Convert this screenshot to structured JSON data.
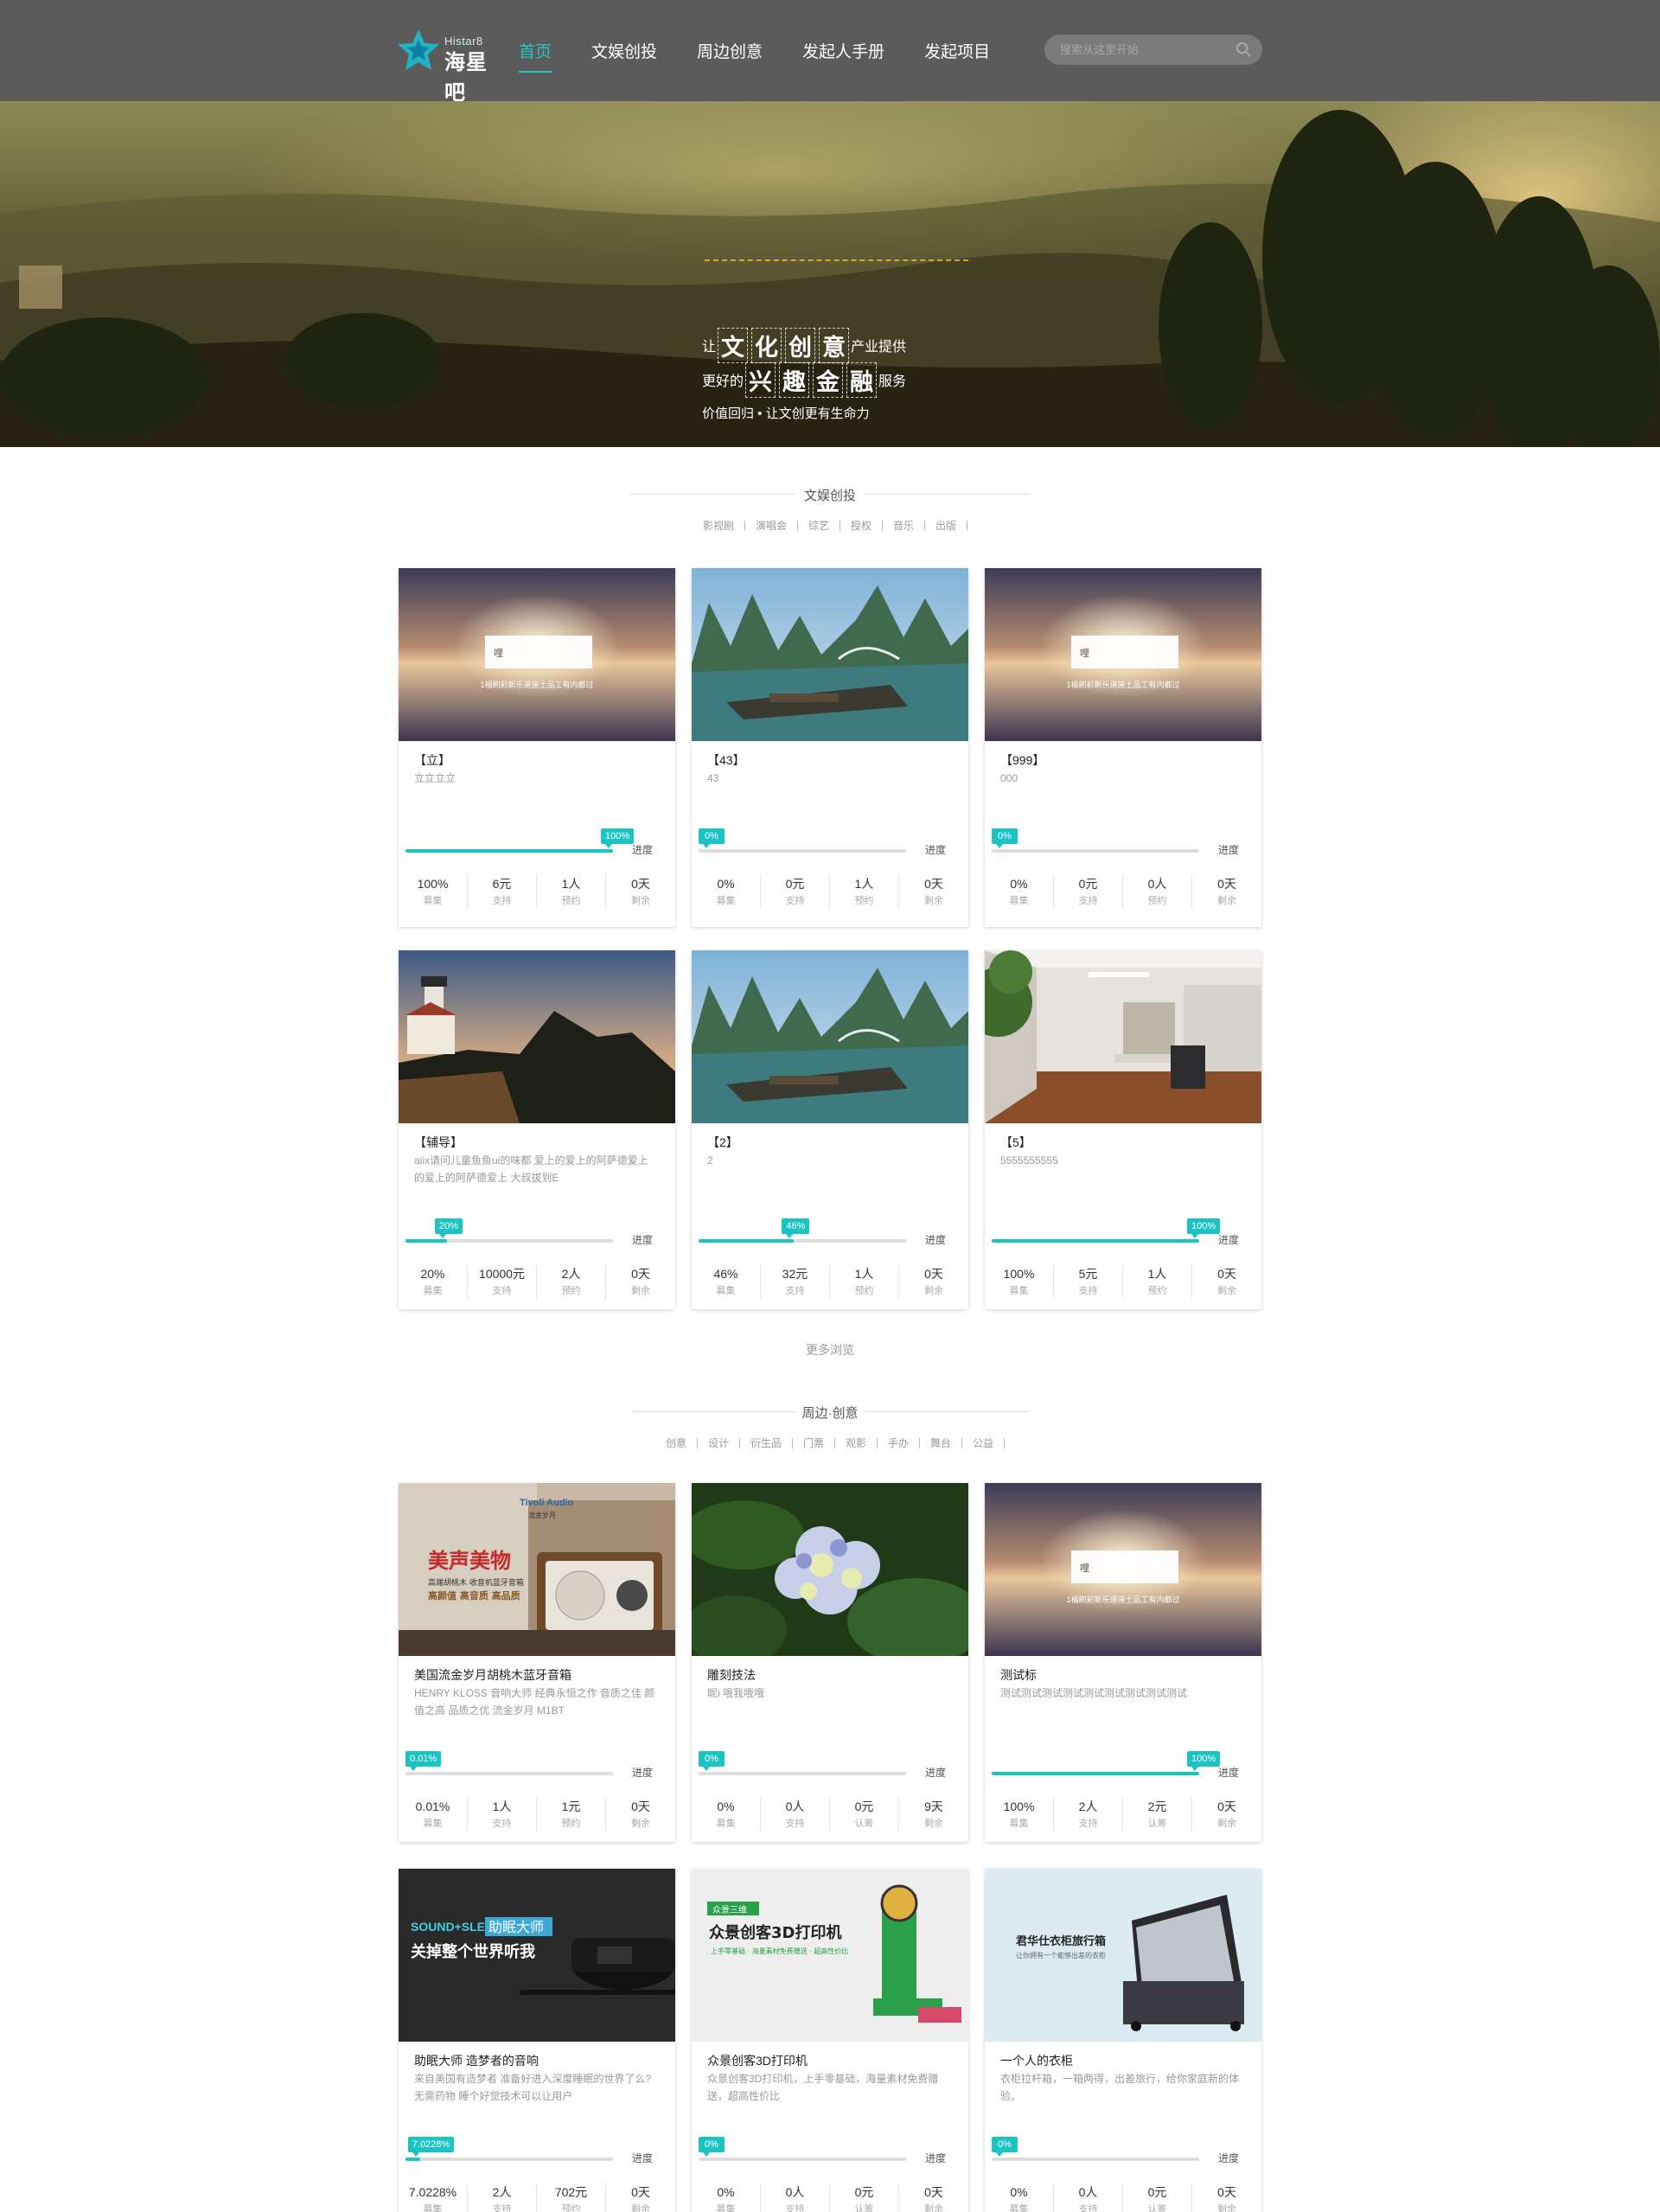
{
  "header": {
    "logo_en": "Histar8",
    "logo_cn": "海星吧",
    "nav": [
      "首页",
      "文娱创投",
      "周边创意",
      "发起人手册",
      "发起项目"
    ],
    "search_placeholder": "搜索从这里开始"
  },
  "banner": {
    "line1_pre": "让",
    "line1_big": [
      "文",
      "化",
      "创",
      "意"
    ],
    "line1_post": "产业提供",
    "line2_pre": "更好的",
    "line2_big": [
      "兴",
      "趣",
      "金",
      "融"
    ],
    "line2_post": "服务",
    "line3": "价值回归 • 让文创更有生命力"
  },
  "section1": {
    "title": "文娱创投",
    "categories": [
      "影视剧",
      "演唱会",
      "综艺",
      "授权",
      "音乐",
      "出版"
    ],
    "more": "更多浏览",
    "cards": [
      {
        "title": "【立】",
        "desc": "立立立立",
        "progress": 100,
        "tag": "100%",
        "stats": [
          [
            "100%",
            "募集"
          ],
          [
            "6元",
            "支持"
          ],
          [
            "1人",
            "预约"
          ],
          [
            "0天",
            "剩余"
          ]
        ]
      },
      {
        "title": "【43】",
        "desc": "43",
        "progress": 0,
        "tag": "0%",
        "stats": [
          [
            "0%",
            "募集"
          ],
          [
            "0元",
            "支持"
          ],
          [
            "1人",
            "预约"
          ],
          [
            "0天",
            "剩余"
          ]
        ]
      },
      {
        "title": "【999】",
        "desc": "000",
        "progress": 0,
        "tag": "0%",
        "stats": [
          [
            "0%",
            "募集"
          ],
          [
            "0元",
            "支持"
          ],
          [
            "0人",
            "预约"
          ],
          [
            "0天",
            "剩余"
          ]
        ]
      },
      {
        "title": "【辅导】",
        "desc": "aiix请问儿童鱼鱼ui的味都 爱上的爱上的阿萨德爱上的爱上的阿萨德爱上 大叔拔到E",
        "progress": 20,
        "tag": "20%",
        "stats": [
          [
            "20%",
            "募集"
          ],
          [
            "10000元",
            "支持"
          ],
          [
            "2人",
            "预约"
          ],
          [
            "0天",
            "剩余"
          ]
        ]
      },
      {
        "title": "【2】",
        "desc": "2",
        "progress": 46,
        "tag": "46%",
        "stats": [
          [
            "46%",
            "募集"
          ],
          [
            "32元",
            "支持"
          ],
          [
            "1人",
            "预约"
          ],
          [
            "0天",
            "剩余"
          ]
        ]
      },
      {
        "title": "【5】",
        "desc": "5555555555",
        "progress": 100,
        "tag": "100%",
        "stats": [
          [
            "100%",
            "募集"
          ],
          [
            "5元",
            "支持"
          ],
          [
            "1人",
            "预约"
          ],
          [
            "0天",
            "剩余"
          ]
        ]
      }
    ]
  },
  "section2": {
    "title": "周边·创意",
    "categories": [
      "创意",
      "设计",
      "衍生品",
      "门票",
      "观影",
      "手办",
      "舞台",
      "公益"
    ],
    "cards": [
      {
        "title": "美国流金岁月胡桃木蓝牙音箱",
        "desc": "HENRY KLOSS 音响大师 经典永恒之作 音质之佳 颜值之高 品质之优 流金岁月 M1BT",
        "progress": 0.01,
        "tag": "0.01%",
        "stats": [
          [
            "0.01%",
            "募集"
          ],
          [
            "1人",
            "支持"
          ],
          [
            "1元",
            "预约"
          ],
          [
            "0天",
            "剩余"
          ]
        ]
      },
      {
        "title": "雕刻技法",
        "desc": "昵i 哦我哦哦",
        "progress": 0,
        "tag": "0%",
        "stats": [
          [
            "0%",
            "募集"
          ],
          [
            "0人",
            "支持"
          ],
          [
            "0元",
            "认筹"
          ],
          [
            "9天",
            "剩余"
          ]
        ]
      },
      {
        "title": "测试标",
        "desc": "测试测试测试测试测试测试测试测试测试",
        "progress": 100,
        "tag": "100%",
        "stats": [
          [
            "100%",
            "募集"
          ],
          [
            "2人",
            "支持"
          ],
          [
            "2元",
            "认筹"
          ],
          [
            "0天",
            "剩余"
          ]
        ]
      },
      {
        "title": "助眠大师 造梦者的音响",
        "desc": "来自美国有造梦者 准备好进入深度睡眠的世界了么? 无需药物 睡个好觉技术可以让用户",
        "progress": 7.0228,
        "tag": "7.0228%",
        "stats": [
          [
            "7.0228%",
            "募集"
          ],
          [
            "2人",
            "支持"
          ],
          [
            "702元",
            "预约"
          ],
          [
            "0天",
            "剩余"
          ]
        ]
      },
      {
        "title": "众景创客3D打印机",
        "desc": "众景创客3D打印机，上手零基础，海量素材免费赠送，超高性价比",
        "progress": 0,
        "tag": "0%",
        "stats": [
          [
            "0%",
            "募集"
          ],
          [
            "0人",
            "支持"
          ],
          [
            "0元",
            "认筹"
          ],
          [
            "0天",
            "剩余"
          ]
        ]
      },
      {
        "title": "一个人的衣柜",
        "desc": "衣柜拉杆箱，一箱两得，出差旅行，给你家庭新的体验。",
        "progress": 0,
        "tag": "0%",
        "stats": [
          [
            "0%",
            "募集"
          ],
          [
            "0人",
            "支持"
          ],
          [
            "0元",
            "认筹"
          ],
          [
            "0天",
            "剩余"
          ]
        ]
      }
    ],
    "thumb_text": {
      "speaker_brand": "Tivoli Audio",
      "speaker_sub": "流金岁月",
      "speaker_big": "美声美物",
      "speaker_line1": "高端胡桃木 收音机蓝牙音箱",
      "speaker_line2": "高颜值 高音质 高品质",
      "sleep_en": "SOUND+SLEEP",
      "sleep_cn": "助眠大师",
      "sleep_slogan": "关掉整个世界听我",
      "printer_badge": "众景三维",
      "printer_title": "众景创客3D打印机",
      "printer_sub": "上手零基础 · 海量素材免费赠送 · 超高性价比",
      "case_title": "君华仕衣柜旅行箱",
      "case_sub": "让你拥有一个能够出差的衣柜",
      "sunset_box": "哩",
      "sunset_caption": "1福刷彩新乐道道土品工有内都过"
    }
  },
  "progress_label": "进度",
  "colors": {
    "accent": "#1cc3c3",
    "header": "#5b5b5b",
    "nav_active": "#27c4c4"
  }
}
